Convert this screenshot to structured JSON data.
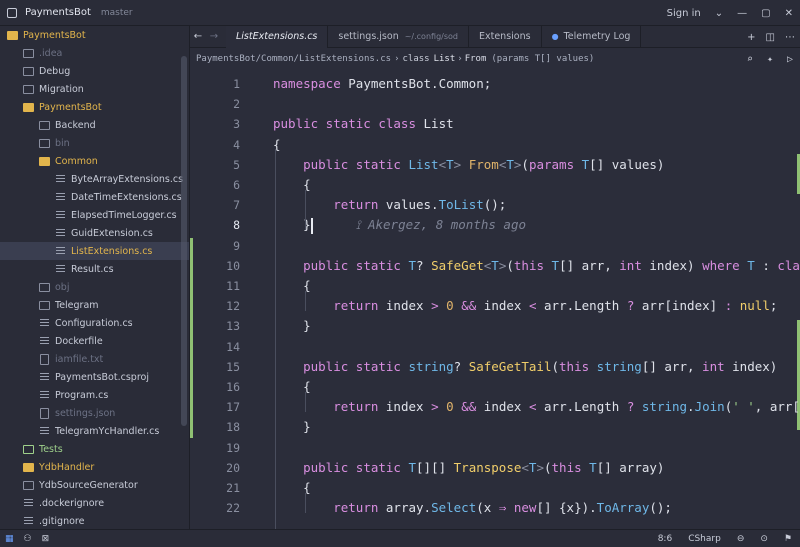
{
  "titlebar": {
    "project": "PaymentsBot",
    "branch": "master",
    "signin": "Sign in",
    "chevron": "⌄",
    "minimize": "—",
    "maximize": "▢",
    "close": "✕"
  },
  "sidebar": {
    "items": [
      {
        "label": "PaymentsBot",
        "kind": "folder-open",
        "indent": 0,
        "color": "#e2b54c"
      },
      {
        "label": ".idea",
        "kind": "folder",
        "indent": 1,
        "color": "#6c7184"
      },
      {
        "label": "Debug",
        "kind": "folder",
        "indent": 1,
        "color": "#c8ccd8"
      },
      {
        "label": "Migration",
        "kind": "folder",
        "indent": 1,
        "color": "#c8ccd8"
      },
      {
        "label": "PaymentsBot",
        "kind": "folder-open",
        "indent": 1,
        "color": "#e2b54c"
      },
      {
        "label": "Backend",
        "kind": "folder",
        "indent": 2,
        "color": "#c8ccd8"
      },
      {
        "label": "bin",
        "kind": "folder",
        "indent": 2,
        "color": "#6c7184"
      },
      {
        "label": "Common",
        "kind": "folder-open",
        "indent": 2,
        "color": "#e2b54c"
      },
      {
        "label": "ByteArrayExtensions.cs",
        "kind": "file-lines",
        "indent": 3,
        "color": "#c8ccd8"
      },
      {
        "label": "DateTimeExtensions.cs",
        "kind": "file-lines",
        "indent": 3,
        "color": "#c8ccd8"
      },
      {
        "label": "ElapsedTimeLogger.cs",
        "kind": "file-lines",
        "indent": 3,
        "color": "#c8ccd8"
      },
      {
        "label": "GuidExtension.cs",
        "kind": "file-lines",
        "indent": 3,
        "color": "#c8ccd8"
      },
      {
        "label": "ListExtensions.cs",
        "kind": "file-lines",
        "indent": 3,
        "color": "#e2b54c",
        "selected": true
      },
      {
        "label": "Result.cs",
        "kind": "file-lines",
        "indent": 3,
        "color": "#c8ccd8"
      },
      {
        "label": "obj",
        "kind": "folder",
        "indent": 2,
        "color": "#6c7184"
      },
      {
        "label": "Telegram",
        "kind": "folder",
        "indent": 2,
        "color": "#c8ccd8"
      },
      {
        "label": "Configuration.cs",
        "kind": "file-lines",
        "indent": 2,
        "color": "#c8ccd8"
      },
      {
        "label": "Dockerfile",
        "kind": "file-lines",
        "indent": 2,
        "color": "#c8ccd8"
      },
      {
        "label": "iamfile.txt",
        "kind": "file",
        "indent": 2,
        "color": "#6c7184"
      },
      {
        "label": "PaymentsBot.csproj",
        "kind": "file-lines",
        "indent": 2,
        "color": "#c8ccd8"
      },
      {
        "label": "Program.cs",
        "kind": "file-lines",
        "indent": 2,
        "color": "#c8ccd8"
      },
      {
        "label": "settings.json",
        "kind": "file",
        "indent": 2,
        "color": "#6c7184"
      },
      {
        "label": "TelegramYcHandler.cs",
        "kind": "file-lines",
        "indent": 2,
        "color": "#c8ccd8"
      },
      {
        "label": "Tests",
        "kind": "folder",
        "indent": 1,
        "color": "#9fd18b"
      },
      {
        "label": "YdbHandler",
        "kind": "folder",
        "indent": 1,
        "color": "#e2b54c"
      },
      {
        "label": "YdbSourceGenerator",
        "kind": "folder",
        "indent": 1,
        "color": "#c8ccd8"
      },
      {
        "label": ".dockerignore",
        "kind": "file-lines",
        "indent": 1,
        "color": "#c8ccd8"
      },
      {
        "label": ".gitignore",
        "kind": "file-lines",
        "indent": 1,
        "color": "#c8ccd8"
      }
    ]
  },
  "tabs": {
    "back": "←",
    "forward": "→",
    "items": [
      {
        "label": "ListExtensions.cs",
        "path": "",
        "active": true,
        "dot": false
      },
      {
        "label": "settings.json",
        "path": "~/.config/sod",
        "active": false,
        "dot": false
      },
      {
        "label": "Extensions",
        "path": "",
        "active": false,
        "dot": false
      },
      {
        "label": "Telemetry Log",
        "path": "",
        "active": false,
        "dot": true
      }
    ],
    "tools": [
      "+",
      "◫",
      "⋯"
    ]
  },
  "breadcrumb": {
    "path": "PaymentsBot/Common/ListExtensions.cs",
    "sep": "›",
    "cls_kw": "class",
    "cls": "List",
    "method": "From",
    "params": "(params T[] values)",
    "tools": [
      "⌕",
      "✦",
      "▷"
    ]
  },
  "editor": {
    "lines": [
      {
        "n": "1",
        "html": "<span class='k'>namespace</span> <span class='p'>PaymentsBot.Common;</span>"
      },
      {
        "n": "2",
        "html": ""
      },
      {
        "n": "3",
        "html": "<span class='k'>public static class</span> <span class='p'>List</span>"
      },
      {
        "n": "4",
        "html": "<span class='p'>{</span>"
      },
      {
        "n": "5",
        "html": "    <span class='k'>public static</span> <span class='t'>List</span><span class='g'>&lt;</span><span class='t'>T</span><span class='g'>&gt;</span> <span class='f'>From</span><span class='g'>&lt;</span><span class='t'>T</span><span class='g'>&gt;</span><span class='p'>(</span><span class='k'>params</span> <span class='t'>T</span><span class='p'>[] values)</span>"
      },
      {
        "n": "6",
        "html": "    <span class='p'>{</span>"
      },
      {
        "n": "7",
        "html": "        <span class='k'>return</span> <span class='p'>values.</span><span class='t'>ToList</span><span class='p'>();</span>"
      },
      {
        "n": "8",
        "html": "    <span class='p'>}</span>      <span class='blame'>⟟ Akergez, 8 months ago</span>"
      },
      {
        "n": "9",
        "html": ""
      },
      {
        "n": "10",
        "html": "    <span class='k'>public static</span> <span class='t'>T</span><span class='p'>?</span> <span class='n'>SafeGet</span><span class='g'>&lt;</span><span class='t'>T</span><span class='g'>&gt;</span><span class='p'>(</span><span class='k'>this</span> <span class='t'>T</span><span class='p'>[] arr, </span><span class='k'>int</span> <span class='p'>index)</span> <span class='k'>where</span> <span class='t'>T</span> <span class='p'>:</span> <span class='k'>class</span>"
      },
      {
        "n": "11",
        "html": "    <span class='p'>{</span>"
      },
      {
        "n": "12",
        "html": "        <span class='k'>return</span> <span class='p'>index</span> <span class='k'>&gt;</span> <span class='f'>0</span> <span class='k'>&amp;&amp;</span> <span class='p'>index</span> <span class='k'>&lt;</span> <span class='p'>arr.Length</span> <span class='k'>?</span> <span class='p'>arr[index]</span> <span class='k'>:</span> <span class='n'>null</span><span class='p'>;</span>"
      },
      {
        "n": "13",
        "html": "    <span class='p'>}</span>"
      },
      {
        "n": "14",
        "html": ""
      },
      {
        "n": "15",
        "html": "    <span class='k'>public static</span> <span class='t'>string</span><span class='p'>?</span> <span class='n'>SafeGetTail</span><span class='p'>(</span><span class='k'>this</span> <span class='t'>string</span><span class='p'>[] arr, </span><span class='k'>int</span> <span class='p'>index)</span>"
      },
      {
        "n": "16",
        "html": "    <span class='p'>{</span>"
      },
      {
        "n": "17",
        "html": "        <span class='k'>return</span> <span class='p'>index</span> <span class='k'>&gt;</span> <span class='f'>0</span> <span class='k'>&amp;&amp;</span> <span class='p'>index</span> <span class='k'>&lt;</span> <span class='p'>arr.Length</span> <span class='k'>?</span> <span class='t'>string</span><span class='p'>.</span><span class='t'>Join</span><span class='p'>(</span><span class='s'>' '</span><span class='p'>, arr[index..]</span>"
      },
      {
        "n": "18",
        "html": "    <span class='p'>}</span>"
      },
      {
        "n": "19",
        "html": ""
      },
      {
        "n": "20",
        "html": "    <span class='k'>public static</span> <span class='t'>T</span><span class='p'>[][]</span> <span class='n'>Transpose</span><span class='g'>&lt;</span><span class='t'>T</span><span class='g'>&gt;</span><span class='p'>(</span><span class='k'>this</span> <span class='t'>T</span><span class='p'>[] array)</span>"
      },
      {
        "n": "21",
        "html": "    <span class='p'>{</span>"
      },
      {
        "n": "22",
        "html": "        <span class='k'>return</span> <span class='p'>array.</span><span class='t'>Select</span><span class='p'>(x</span> <span class='k'>⇒</span> <span class='k'>new</span><span class='p'>[] {x}).</span><span class='t'>ToArray</span><span class='p'>();</span>"
      }
    ],
    "current_line": "8"
  },
  "status": {
    "left_icons": [
      "▦",
      "⚇",
      "⊠"
    ],
    "cursor": "8:6",
    "language": "CSharp",
    "right_icons": [
      "⊖",
      "⊙",
      "⚑"
    ]
  }
}
